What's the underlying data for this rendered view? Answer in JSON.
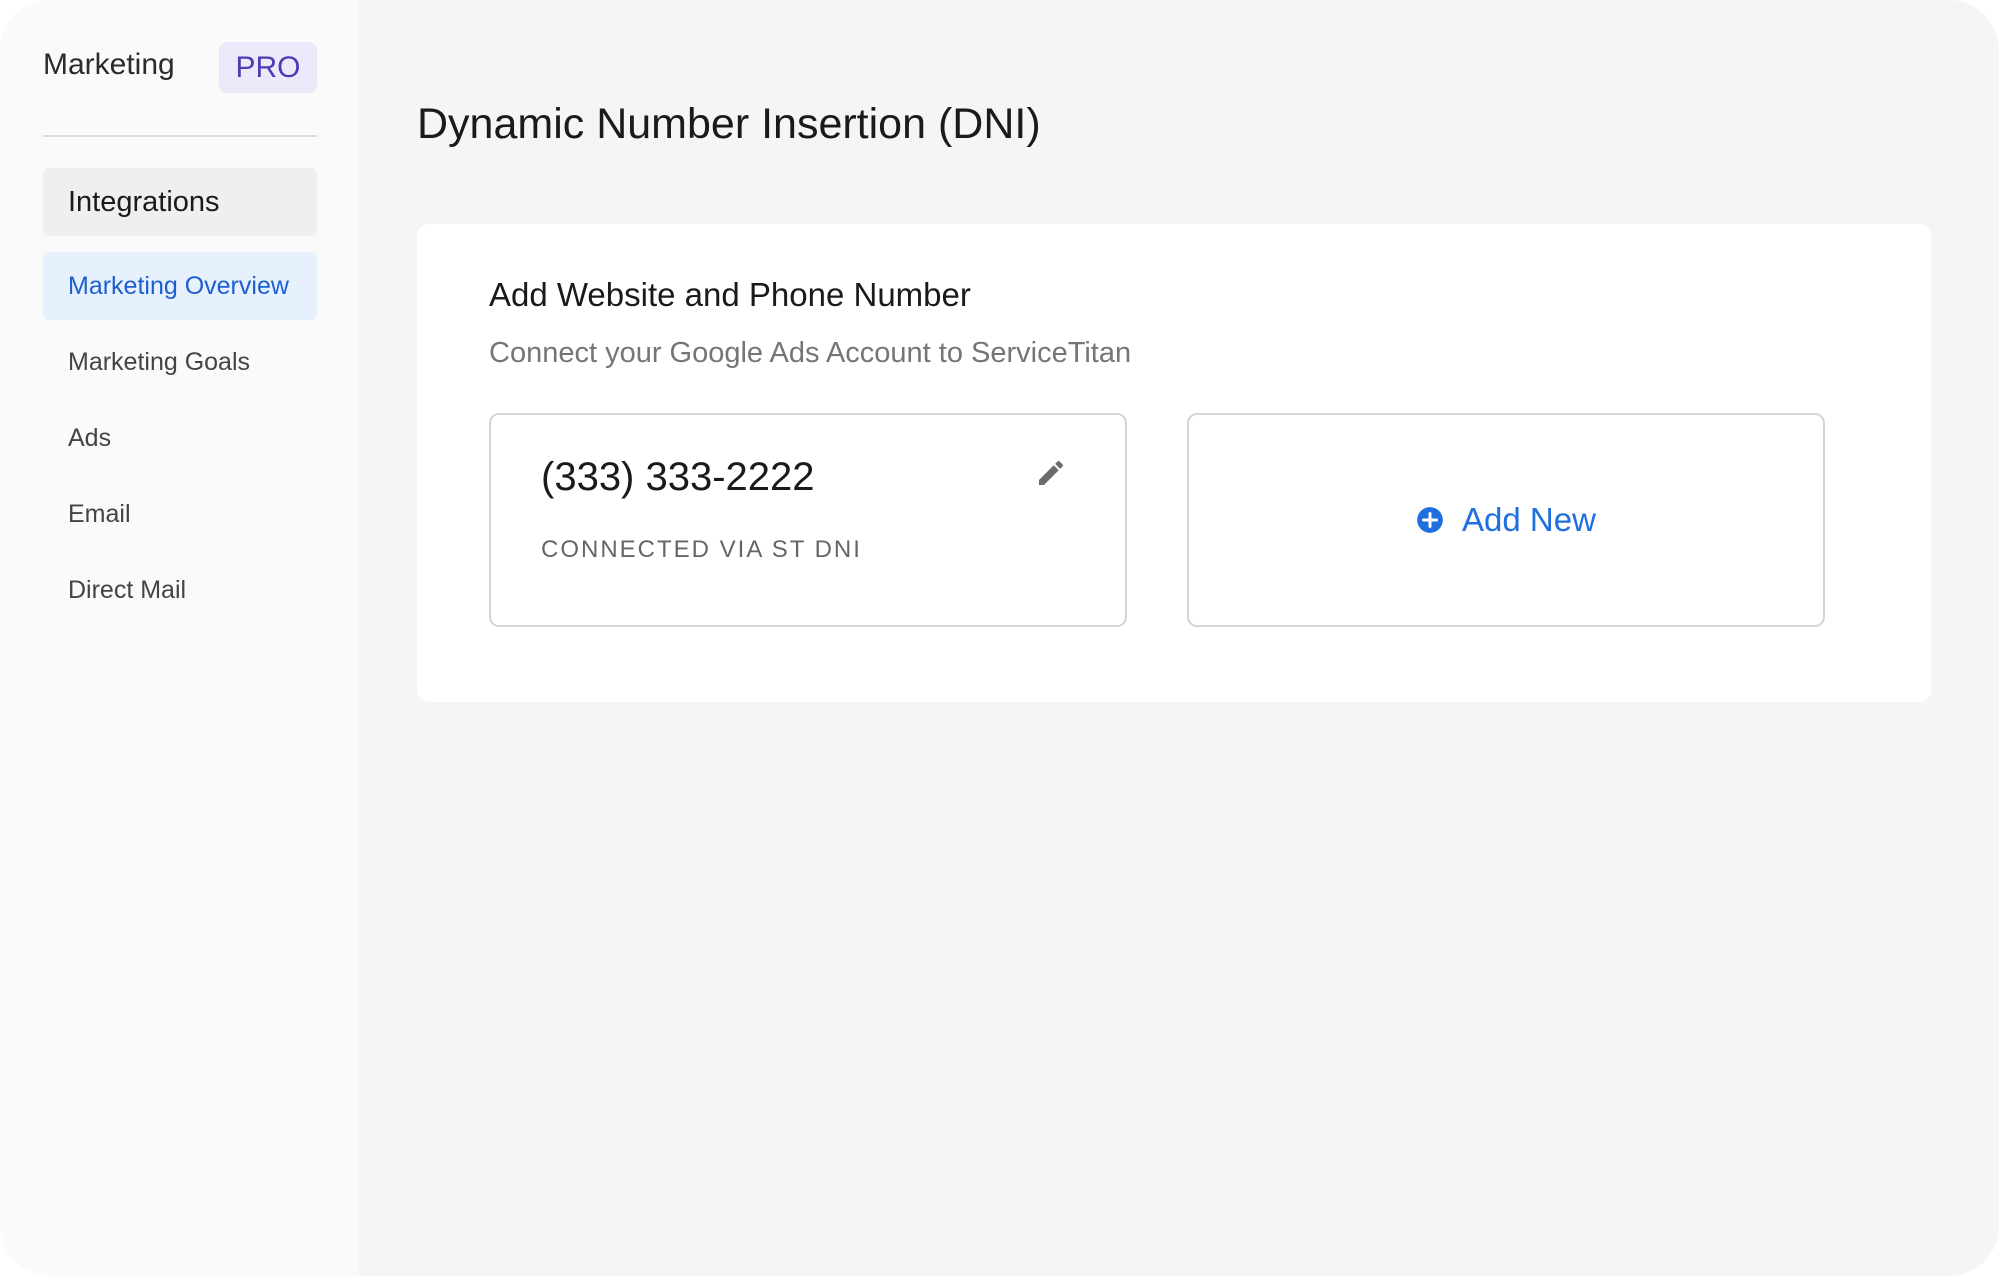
{
  "sidebar": {
    "brand": "Marketing",
    "badge": "PRO",
    "group_label": "Integrations",
    "items": [
      {
        "label": "Marketing Overview",
        "active": true
      },
      {
        "label": "Marketing Goals",
        "active": false
      },
      {
        "label": "Ads",
        "active": false
      },
      {
        "label": "Email",
        "active": false
      },
      {
        "label": "Direct Mail",
        "active": false
      }
    ]
  },
  "main": {
    "title": "Dynamic Number Insertion (DNI)",
    "card": {
      "title": "Add Website and Phone Number",
      "subtitle": "Connect your Google Ads Account to ServiceTitan",
      "numbers": [
        {
          "phone": "(333) 333-2222",
          "status": "CONNECTED VIA ST DNI",
          "action_icon": "pencil-icon"
        }
      ],
      "add_label": "Add New",
      "add_icon": "plus-circle-icon"
    }
  },
  "colors": {
    "accent": "#1f6fe0",
    "active_nav_bg": "#e7f0fd",
    "badge_bg": "#ece9fb",
    "badge_text": "#4f3cb3"
  }
}
